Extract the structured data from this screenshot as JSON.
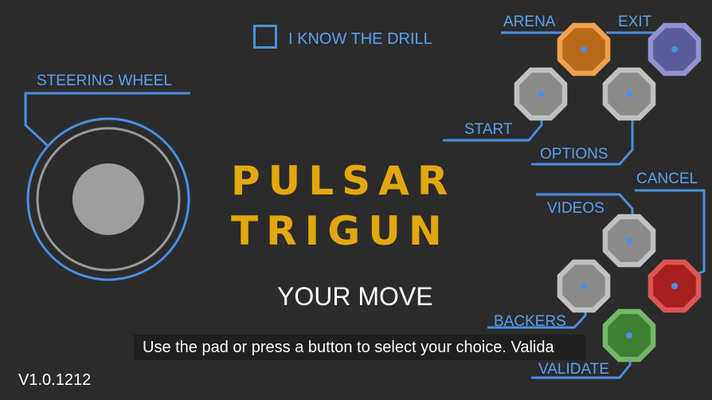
{
  "title": {
    "line1": "PULSAR",
    "line2": "TRIGUN"
  },
  "subtitle": "YOUR MOVE",
  "hint": "Use the pad or press a button to select your choice. Valida",
  "version": "V1.0.1212",
  "drill_checkbox": {
    "label": "I KNOW THE DRILL",
    "checked": false
  },
  "steering_wheel": {
    "label": "STEERING WHEEL"
  },
  "buttons": {
    "arena": {
      "label": "ARENA",
      "color": "#b86a1a"
    },
    "exit": {
      "label": "EXIT",
      "color": "#5b5a9a"
    },
    "start": {
      "label": "START",
      "color": "#8a8a8a"
    },
    "options": {
      "label": "OPTIONS",
      "color": "#8a8a8a"
    },
    "videos": {
      "label": "VIDEOS",
      "color": "#8a8a8a"
    },
    "cancel": {
      "label": "CANCEL",
      "color": "#a51f1f"
    },
    "backers": {
      "label": "BACKERS",
      "color": "#8a8a8a"
    },
    "validate": {
      "label": "VALIDATE",
      "color": "#3f7f33"
    }
  },
  "colors": {
    "background": "#2b2b2b",
    "accent_line": "#4a8fe0",
    "title": "#e3a810"
  }
}
